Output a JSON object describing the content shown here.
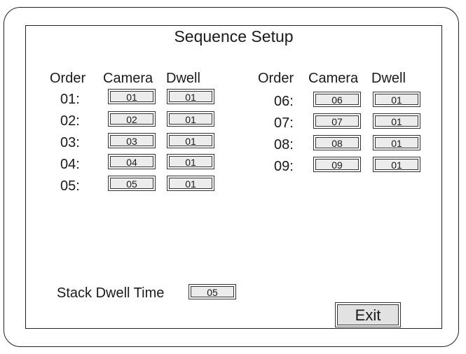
{
  "title": "Sequence Setup",
  "headers": {
    "order": "Order",
    "camera": "Camera",
    "dwell": "Dwell"
  },
  "left_rows": [
    {
      "order": "01:",
      "camera": "01",
      "dwell": "01"
    },
    {
      "order": "02:",
      "camera": "02",
      "dwell": "01"
    },
    {
      "order": "03:",
      "camera": "03",
      "dwell": "01"
    },
    {
      "order": "04:",
      "camera": "04",
      "dwell": "01"
    },
    {
      "order": "05:",
      "camera": "05",
      "dwell": "01"
    }
  ],
  "right_rows": [
    {
      "order": "06:",
      "camera": "06",
      "dwell": "01"
    },
    {
      "order": "07:",
      "camera": "07",
      "dwell": "01"
    },
    {
      "order": "08:",
      "camera": "08",
      "dwell": "01"
    },
    {
      "order": "09:",
      "camera": "09",
      "dwell": "01"
    }
  ],
  "stack_dwell": {
    "label": "Stack Dwell Time",
    "value": "05"
  },
  "exit_label": "Exit"
}
